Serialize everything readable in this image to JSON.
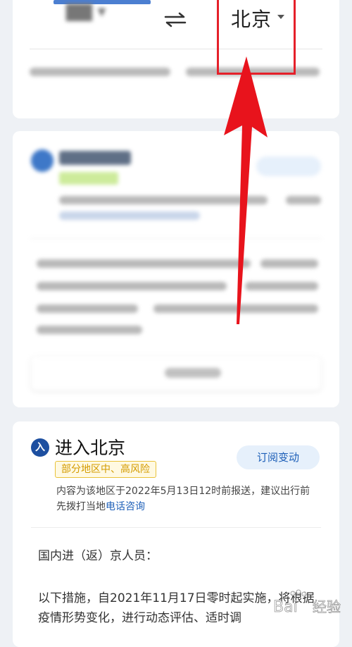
{
  "top_card": {
    "destination_city": "北京",
    "swap_icon": "swap-arrows-icon"
  },
  "entry_card": {
    "icon_glyph": "入",
    "title": "进入北京",
    "risk_badge": "部分地区中、高风险",
    "subscribe_label": "订阅变动",
    "notice_text": "内容为该地区于2022年5月13日12时前报送，建议出行前先拨打当地",
    "notice_link": "电话咨询",
    "intro": "国内进（返）京人员：",
    "paragraph": "以下措施，自2021年11月17日零时起实施，将根据疫情形势变化，进行动态评估、适时调"
  },
  "watermark": {
    "text_latin": "Bai",
    "text_cn": "经验"
  },
  "colors": {
    "accent_blue": "#1d5fb8",
    "annotation_red": "#e5202a",
    "badge_yellow": "#d39b00"
  }
}
